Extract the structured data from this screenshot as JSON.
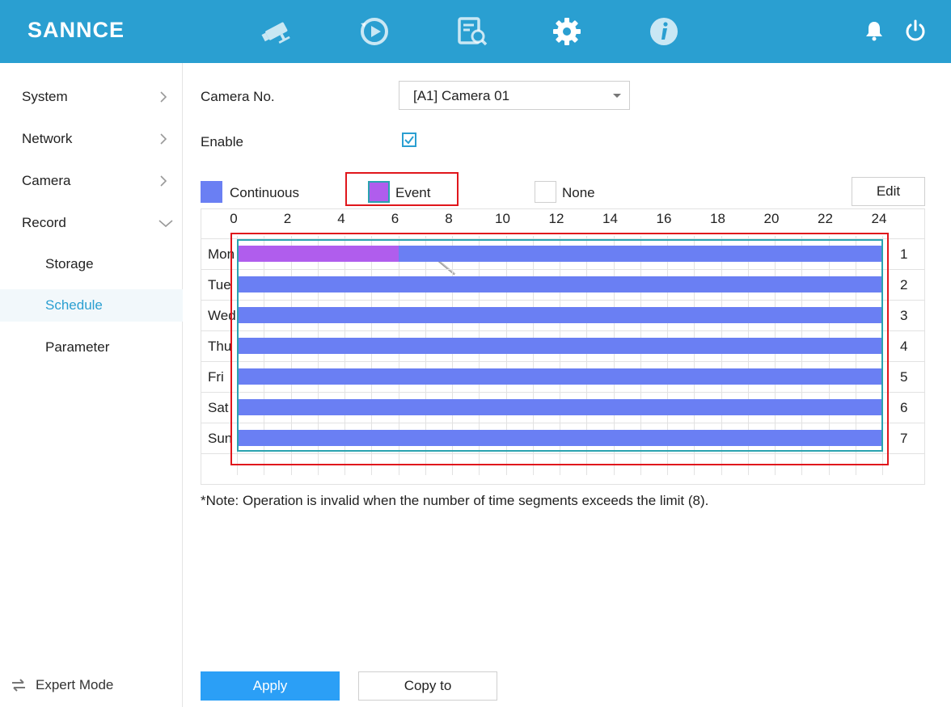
{
  "app": {
    "logo_text": "SANNCE"
  },
  "topnav": {
    "icons": [
      "camera-icon",
      "playback-icon",
      "search-file-icon",
      "gear-icon",
      "info-icon"
    ],
    "active": "gear-icon",
    "right_icons": [
      "bell-icon",
      "power-icon"
    ]
  },
  "sidebar": {
    "items": [
      {
        "label": "System"
      },
      {
        "label": "Network"
      },
      {
        "label": "Camera"
      },
      {
        "label": "Record"
      }
    ],
    "sub_items": [
      {
        "label": "Storage"
      },
      {
        "label": "Schedule",
        "active": true
      },
      {
        "label": "Parameter"
      }
    ],
    "expert_mode": "Expert Mode"
  },
  "form": {
    "camera_label": "Camera No.",
    "camera_value": "[A1] Camera 01",
    "enable_label": "Enable",
    "enable_checked": true
  },
  "legend": {
    "continuous": "Continuous",
    "event": "Event",
    "none": "None",
    "edit": "Edit",
    "colors": {
      "continuous": "#6a7ff3",
      "event": "#b05ded",
      "none": "#ffffff"
    }
  },
  "schedule": {
    "hour_labels": [
      "0",
      "2",
      "4",
      "6",
      "8",
      "10",
      "12",
      "14",
      "16",
      "18",
      "20",
      "22",
      "24"
    ],
    "days": [
      {
        "label": "Mon",
        "num": "1",
        "segments": [
          {
            "type": "event",
            "start": 0,
            "end": 6
          },
          {
            "type": "continuous",
            "start": 6,
            "end": 24
          }
        ]
      },
      {
        "label": "Tue",
        "num": "2",
        "segments": [
          {
            "type": "continuous",
            "start": 0,
            "end": 24
          }
        ]
      },
      {
        "label": "Wed",
        "num": "3",
        "segments": [
          {
            "type": "continuous",
            "start": 0,
            "end": 24
          }
        ]
      },
      {
        "label": "Thu",
        "num": "4",
        "segments": [
          {
            "type": "continuous",
            "start": 0,
            "end": 24
          }
        ]
      },
      {
        "label": "Fri",
        "num": "5",
        "segments": [
          {
            "type": "continuous",
            "start": 0,
            "end": 24
          }
        ]
      },
      {
        "label": "Sat",
        "num": "6",
        "segments": [
          {
            "type": "continuous",
            "start": 0,
            "end": 24
          }
        ]
      },
      {
        "label": "Sun",
        "num": "7",
        "segments": [
          {
            "type": "continuous",
            "start": 0,
            "end": 24
          }
        ]
      }
    ]
  },
  "note": "*Note: Operation is invalid when the number of time segments exceeds the limit (8).",
  "buttons": {
    "apply": "Apply",
    "copy_to": "Copy to"
  }
}
